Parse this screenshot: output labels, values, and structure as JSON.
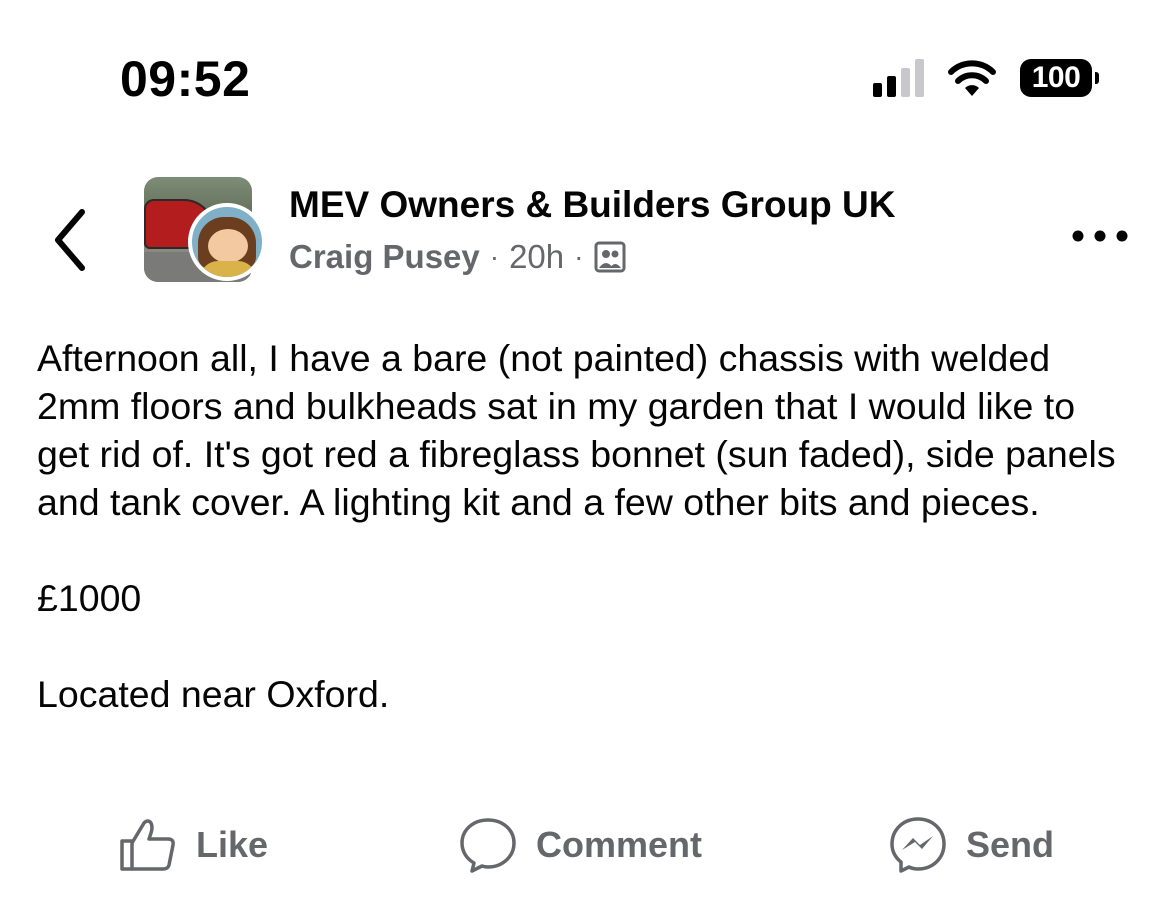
{
  "status_bar": {
    "time": "09:52",
    "battery": "100",
    "signal_bars_active": 2,
    "signal_bars_total": 4
  },
  "header": {
    "group_name": "MEV Owners & Builders Group UK",
    "author": "Craig Pusey",
    "separator": "·",
    "time_ago": "20h",
    "audience_icon": "group-audience-icon",
    "back_icon": "chevron-left-icon",
    "more_icon": "more-horizontal-icon"
  },
  "post": {
    "paragraphs": [
      "Afternoon all, I have a bare (not painted) chassis with welded 2mm floors and bulkheads sat in my garden that I would like to get rid of. It's got red a fibreglass bonnet (sun faded), side panels and tank cover. A lighting kit and a few other bits and pieces.",
      "£1000",
      "Located near Oxford."
    ]
  },
  "actions": {
    "like": {
      "label": "Like",
      "icon": "thumbs-up-icon"
    },
    "comment": {
      "label": "Comment",
      "icon": "comment-bubble-icon"
    },
    "send": {
      "label": "Send",
      "icon": "messenger-icon"
    }
  },
  "colors": {
    "text_primary": "#050505",
    "text_secondary": "#65676b",
    "background": "#ffffff"
  }
}
